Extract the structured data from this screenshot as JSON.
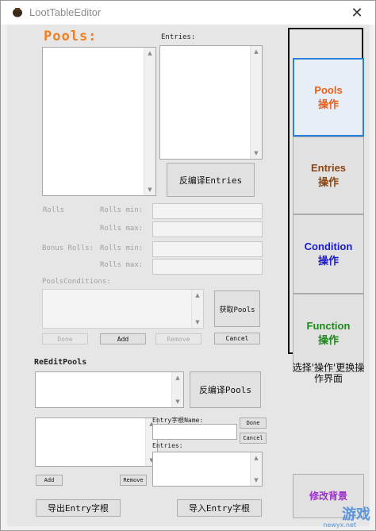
{
  "window": {
    "title": "LootTableEditor",
    "close_glyph": "✕"
  },
  "pools": {
    "title": "Pools:",
    "entries_label": "Entries:",
    "decompile_entries": "反编译Entries",
    "rolls_label": "Rolls",
    "rolls_min_label": "Rolls min:",
    "rolls_max_label": "Rolls max:",
    "bonus_rolls_label": "Bonus Rolls:",
    "bonus_min_label": "Rolls min:",
    "bonus_max_label": "Rolls max:",
    "conditions_label": "PoolsConditions:",
    "get_pools": "获取Pools",
    "done": "Done",
    "add": "Add",
    "remove": "Remove",
    "cancel": "Cancel"
  },
  "reedit": {
    "title": "ReEditPools",
    "decompile_pools": "反编译Pools",
    "entry_name_label": "Entry字根Name:",
    "done": "Done",
    "cancel": "Cancel",
    "entries_label": "Entries:",
    "add": "Add",
    "remove": "Remove",
    "export": "导出Entry字根",
    "import": "导入Entry字根"
  },
  "side": {
    "pools_line1": "Pools",
    "pools_line2": "操作",
    "entries_line1": "Entries",
    "entries_line2": "操作",
    "condition_line1": "Condition",
    "condition_line2": "操作",
    "function_line1": "Function",
    "function_line2": "操作",
    "hint": "选择'操作'更换操作界面",
    "bg_button": "修改背景"
  },
  "watermark": {
    "logo": "游戏",
    "url": "newyx.net"
  },
  "colors": {
    "pools": "#e8601c",
    "entries": "#8b4513",
    "condition": "#1a1acc",
    "function": "#1a8a1a",
    "bg_button": "#9b30c8",
    "pools_title": "#f08020"
  }
}
